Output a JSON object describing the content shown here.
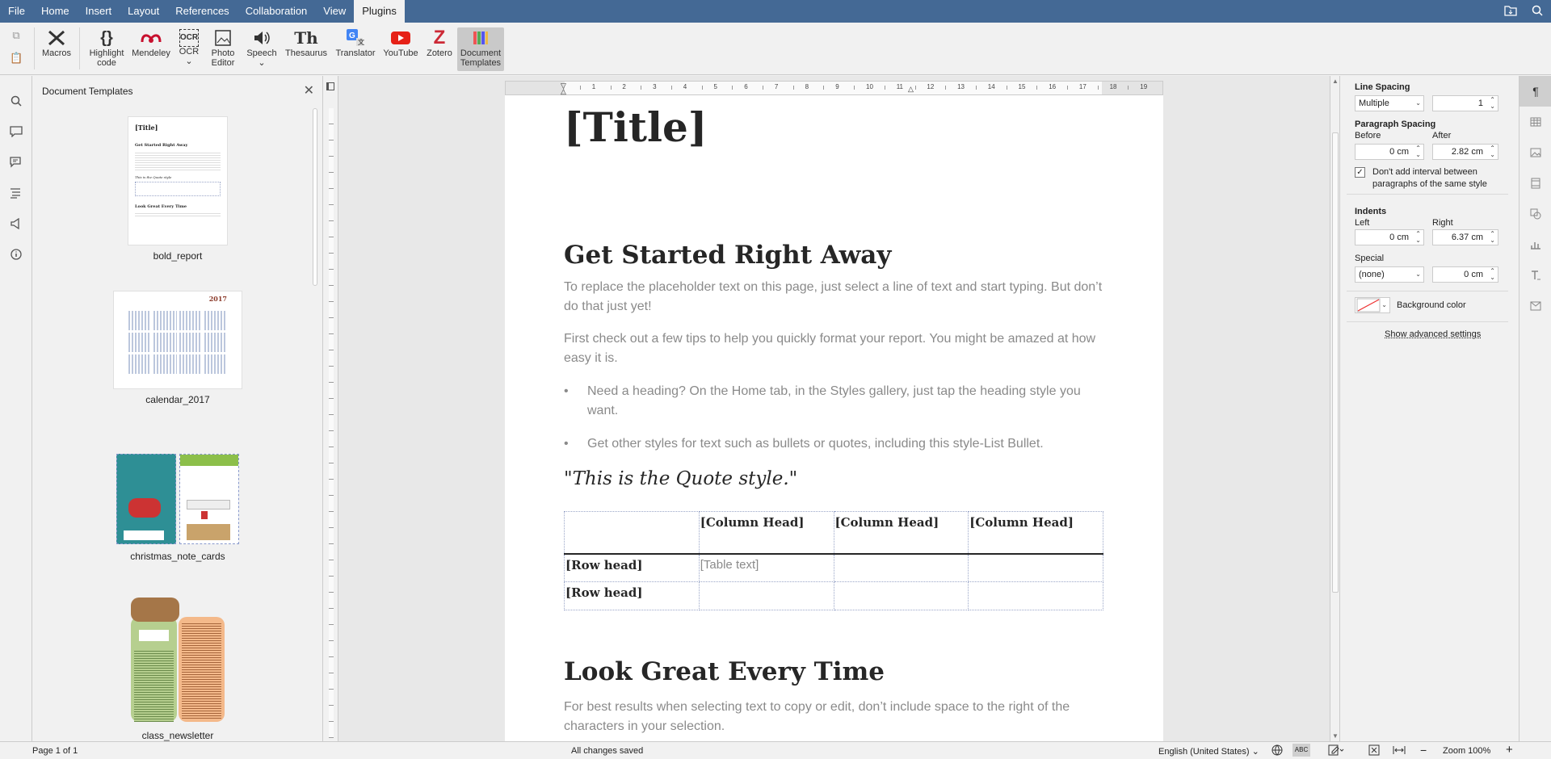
{
  "menu": {
    "tabs": [
      "File",
      "Home",
      "Insert",
      "Layout",
      "References",
      "Collaboration",
      "View",
      "Plugins"
    ],
    "active": "Plugins"
  },
  "toolbar": {
    "buttons": [
      {
        "label": "Macros",
        "icon": "macros-icon"
      },
      {
        "label": "Highlight code",
        "icon": "code-braces-icon"
      },
      {
        "label": "Mendeley",
        "icon": "mendeley-icon"
      },
      {
        "label": "OCR",
        "icon": "ocr-icon"
      },
      {
        "label": "Photo Editor",
        "icon": "photo-editor-icon"
      },
      {
        "label": "Speech",
        "icon": "speaker-icon"
      },
      {
        "label": "Thesaurus",
        "icon": "thesaurus-icon"
      },
      {
        "label": "Translator",
        "icon": "translator-icon"
      },
      {
        "label": "YouTube",
        "icon": "youtube-icon"
      },
      {
        "label": "Zotero",
        "icon": "zotero-icon"
      },
      {
        "label": "Document Templates",
        "icon": "document-templates-icon"
      }
    ],
    "labels": {
      "macros": "Macros",
      "highlight1": "Highlight",
      "highlight2": "code",
      "mendeley": "Mendeley",
      "ocr": "OCR",
      "photo1": "Photo",
      "photo2": "Editor",
      "speech": "Speech",
      "thesaurus": "Thesaurus",
      "translator": "Translator",
      "youtube": "YouTube",
      "zotero": "Zotero",
      "doctpl1": "Document",
      "doctpl2": "Templates",
      "ocr_glyph": "OCR",
      "thesaurus_glyph": "Th",
      "zotero_glyph": "Z",
      "highlight_glyph": "{}"
    }
  },
  "templates_panel": {
    "title": "Document Templates",
    "items": [
      "bold_report",
      "calendar_2017",
      "christmas_note_cards",
      "class_newsletter"
    ],
    "thumb_texts": {
      "title": "[Title]",
      "get_started": "Get Started Right Away",
      "quote": "This is the Quote style",
      "look_great": "Look Great Every Time",
      "year": "2017"
    }
  },
  "document": {
    "title": "[Title]",
    "h1": "Get Started Right Away",
    "p1": "To replace the placeholder text on this page, just select a line of text and start typing. But don’t do that just yet!",
    "p2": "First check out a few tips to help you quickly format your report. You might be amazed at how easy it is.",
    "b1": "Need a heading? On the Home tab, in the Styles gallery, just tap the heading style you want.",
    "b2": "Get other styles for text such as bullets or quotes, including this style-List Bullet.",
    "quote": "\"This is the Quote style.\"",
    "table": {
      "col_head": "[Column Head]",
      "row_head": "[Row head]",
      "cell": "[Table text]"
    },
    "h2": "Look Great Every Time",
    "p3": "For best results when selecting text to copy or edit, don’t include space to the right of the characters in your selection."
  },
  "paragraph_settings": {
    "line_spacing_label": "Line Spacing",
    "line_spacing_type": "Multiple",
    "line_spacing_value": "1",
    "paragraph_spacing_label": "Paragraph Spacing",
    "before_label": "Before",
    "before_value": "0 cm",
    "after_label": "After",
    "after_value": "2.82 cm",
    "no_interval_label": "Don't add interval between paragraphs of the same style",
    "no_interval_checked": true,
    "indents_label": "Indents",
    "left_label": "Left",
    "left_value": "0 cm",
    "right_label": "Right",
    "right_value": "6.37 cm",
    "special_label": "Special",
    "special_type": "(none)",
    "special_value": "0 cm",
    "background_label": "Background color",
    "advanced_link": "Show advanced settings"
  },
  "status": {
    "page": "Page 1 of 1",
    "saved": "All changes saved",
    "language": "English (United States)",
    "zoom": "Zoom 100%"
  },
  "colors": {
    "menubar": "#446995",
    "page": "#ffffff",
    "muted_text": "#8a8a8a"
  },
  "ruler": {
    "h_marks": [
      "1",
      "2",
      "3",
      "4",
      "5",
      "6",
      "7",
      "8",
      "9",
      "10",
      "11",
      "12",
      "13",
      "14",
      "15",
      "16",
      "17",
      "18",
      "19"
    ]
  }
}
